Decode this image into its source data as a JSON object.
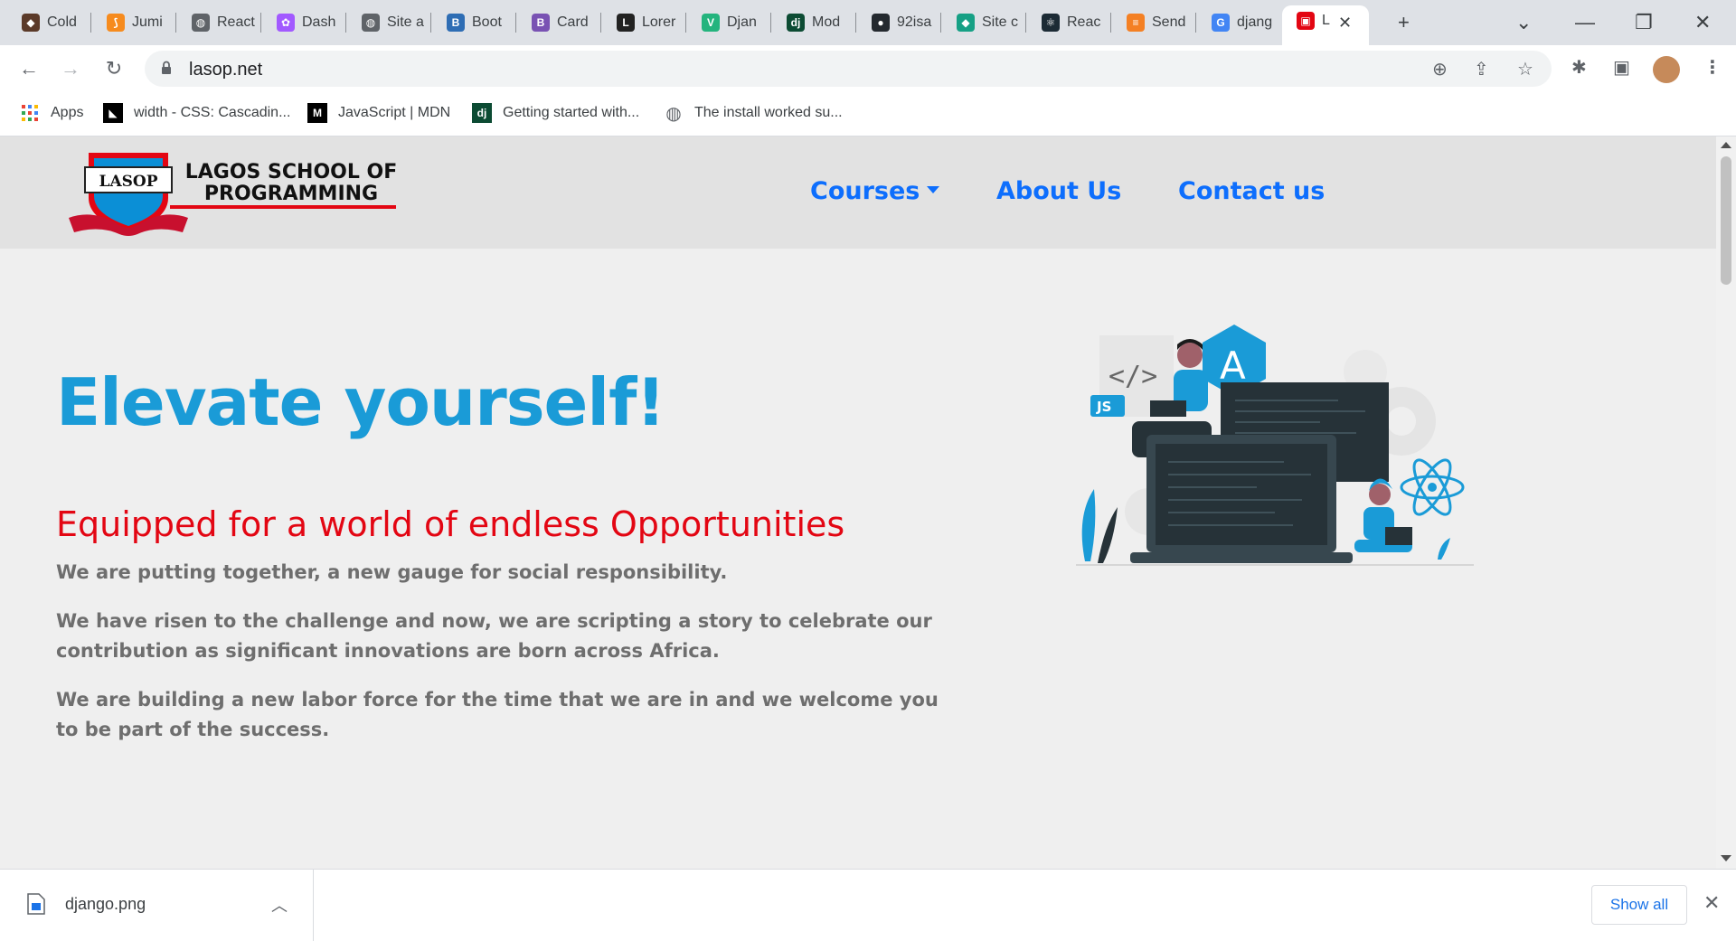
{
  "browser": {
    "tabs": [
      {
        "label": "Cold",
        "icon": "coldplay-icon",
        "color": "#5b3a29"
      },
      {
        "label": "Jumi",
        "icon": "jumia-icon",
        "color": "#f68b1e"
      },
      {
        "label": "React",
        "icon": "globe-icon",
        "color": "#5f6368"
      },
      {
        "label": "Dash",
        "icon": "figma-icon",
        "color": "#a259ff"
      },
      {
        "label": "Site a",
        "icon": "globe-icon",
        "color": "#5f6368"
      },
      {
        "label": "Boot",
        "icon": "bootstrap-icon",
        "color": "#2e6db4"
      },
      {
        "label": "Card",
        "icon": "bootstrap-icon",
        "color": "#7952b3"
      },
      {
        "label": "Lorer",
        "icon": "lorem-icon",
        "color": "#222222"
      },
      {
        "label": "Djan",
        "icon": "vue-icon",
        "color": "#24b47e"
      },
      {
        "label": "Mod",
        "icon": "django-icon",
        "color": "#0c4b33"
      },
      {
        "label": "92isa",
        "icon": "github-icon",
        "color": "#24292f"
      },
      {
        "label": "Site c",
        "icon": "diamond-icon",
        "color": "#16a085"
      },
      {
        "label": "Reac",
        "icon": "react-icon",
        "color": "#1c2b35"
      },
      {
        "label": "Send",
        "icon": "stackoverflow-icon",
        "color": "#f48024"
      },
      {
        "label": "djang",
        "icon": "google-icon",
        "color": "#4285f4"
      },
      {
        "label": "L",
        "icon": "lasop-icon",
        "color": "#e30613",
        "active": true
      }
    ],
    "url": "lasop.net",
    "bookmarks": [
      {
        "label": "Apps",
        "icon": "apps-grid-icon"
      },
      {
        "label": "width - CSS: Cascadin...",
        "icon": "mdn-icon"
      },
      {
        "label": "JavaScript | MDN",
        "icon": "mdn-icon"
      },
      {
        "label": "Getting started with...",
        "icon": "django-icon"
      },
      {
        "label": "The install worked su...",
        "icon": "globe-icon"
      }
    ]
  },
  "site": {
    "logo_badge": "LASOP",
    "logo_title": "LAGOS SCHOOL OF PROGRAMMING",
    "nav": {
      "courses": "Courses",
      "about": "About Us",
      "contact": "Contact us"
    },
    "hero": {
      "title": "Elevate yourself!",
      "subtitle": "Equipped for a world of endless Opportunities",
      "paragraphs": [
        "We are putting together, a new gauge for social responsibility.",
        "We have risen to the challenge and now, we are scripting a story to celebrate our contribution as significant innovations are born across Africa.",
        "We are building a new labor force for the time that we are in and we welcome you to be part of the success."
      ],
      "illustration_labels": {
        "js": "JS",
        "angular": "A",
        "code": "</>"
      }
    }
  },
  "downloads": {
    "file_name": "django.png",
    "show_all": "Show all"
  },
  "colors": {
    "brand_blue": "#0d6efd",
    "hero_blue": "#1a9bd7",
    "brand_red": "#e30613"
  }
}
